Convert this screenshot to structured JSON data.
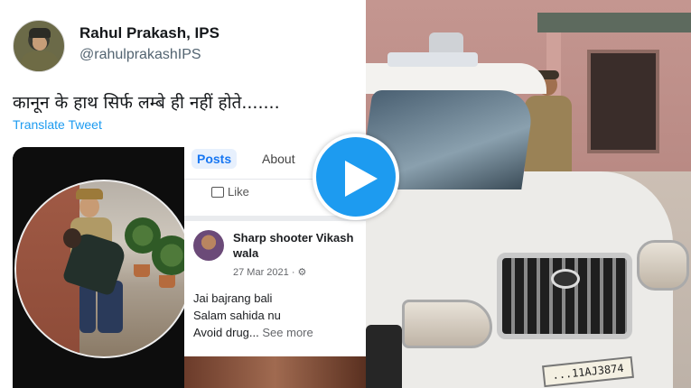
{
  "tweet": {
    "author_name": "Rahul Prakash, IPS",
    "handle": "@rahulprakashIPS",
    "text": "कानून के हाथ सिर्फ लम्बे ही नहीं होते.......",
    "translate_label": "Translate Tweet"
  },
  "facebook_card": {
    "tabs": [
      "Posts",
      "About"
    ],
    "like_label": "Like",
    "author": "Sharp shooter Vikash wala",
    "date": "27 Mar 2021 · ",
    "post_lines": [
      "Jai bajrang bali",
      "Salam sahida nu",
      "Avoid drug... "
    ],
    "see_more": "See more"
  },
  "video": {
    "plate_text": "...11AJ3874",
    "play_icon": "play-icon"
  },
  "colors": {
    "twitter_blue": "#1d9bf0",
    "facebook_blue": "#1877f2",
    "text_dark": "#14171a",
    "text_muted": "#536471"
  }
}
